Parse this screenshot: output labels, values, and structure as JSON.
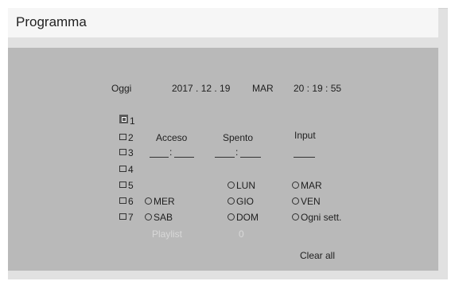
{
  "window": {
    "title": "Programma"
  },
  "today": {
    "label": "Oggi",
    "date": "2017 . 12 . 19",
    "weekday": "MAR",
    "time": "20 : 19 : 55"
  },
  "schedules": [
    "1",
    "2",
    "3",
    "4",
    "5",
    "6",
    "7"
  ],
  "columns": {
    "on": "Acceso",
    "off": "Spento",
    "input": "Input"
  },
  "time_separator": ":",
  "days": {
    "lun": "LUN",
    "mar": "MAR",
    "mer": "MER",
    "gio": "GIO",
    "ven": "VEN",
    "sab": "SAB",
    "dom": "DOM",
    "weekly": "Ogni sett."
  },
  "playlist": {
    "label": "Playlist",
    "value": "0"
  },
  "clear_all": "Clear all",
  "colors": {
    "panel": "#b9b9b9",
    "title_bar": "#f6f6f6",
    "frame": "#e1e1e1",
    "dim_text": "#d8d8d8"
  }
}
